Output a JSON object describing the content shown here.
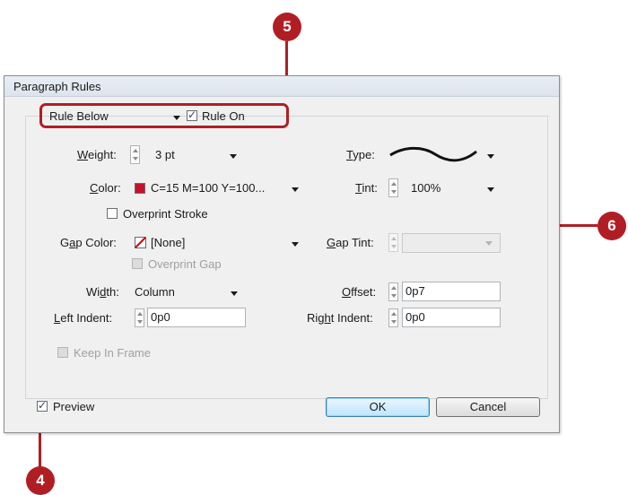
{
  "dialog": {
    "title": "Paragraph Rules",
    "rule_select": "Rule Below",
    "rule_on_label": "Rule On",
    "rule_on_checked": true,
    "weight": {
      "label": "Weight:",
      "value": "3 pt"
    },
    "type": {
      "label": "Type:"
    },
    "color": {
      "label": "Color:",
      "value": "C=15 M=100 Y=100...",
      "swatch_color": "#c8102e"
    },
    "tint": {
      "label": "Tint:",
      "value": "100%"
    },
    "overprint_stroke": {
      "label": "Overprint Stroke",
      "checked": false
    },
    "gap_color": {
      "label": "Gap Color:",
      "value": "[None]"
    },
    "gap_tint": {
      "label": "Gap Tint:",
      "value": ""
    },
    "overprint_gap": {
      "label": "Overprint Gap",
      "checked": false
    },
    "width": {
      "label": "Width:",
      "value": "Column"
    },
    "offset": {
      "label": "Offset:",
      "value": "0p7"
    },
    "left_indent": {
      "label": "Left Indent:",
      "value": "0p0"
    },
    "right_indent": {
      "label": "Right Indent:",
      "value": "0p0"
    },
    "keep_in_frame": {
      "label": "Keep In Frame",
      "checked": false
    },
    "preview": {
      "label": "Preview",
      "checked": true
    },
    "ok_label": "OK",
    "cancel_label": "Cancel"
  },
  "callouts": {
    "five": "5",
    "six": "6",
    "four": "4"
  },
  "colors": {
    "callout": "#b01e24",
    "dialog_bg": "#f0f0f0"
  }
}
